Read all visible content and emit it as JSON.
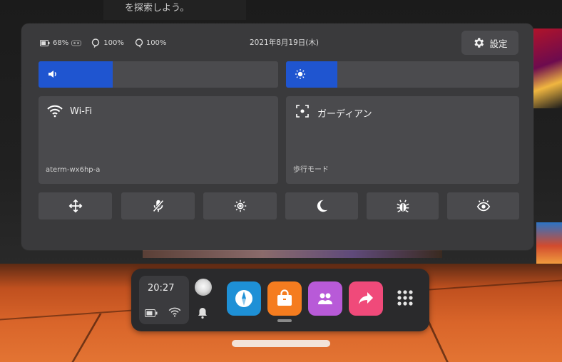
{
  "background": {
    "top_text": "を探索しよう。"
  },
  "status": {
    "headset_battery": "68%",
    "controller_left": "100%",
    "controller_right": "100%",
    "date": "2021年8月19日(木)"
  },
  "settings_button": {
    "label": "設定",
    "icon": "gear-icon"
  },
  "sliders": {
    "volume": {
      "icon": "speaker-icon",
      "level_percent": 31
    },
    "brightness": {
      "icon": "sun-icon",
      "level_percent": 22
    }
  },
  "tiles": {
    "wifi": {
      "icon": "wifi-icon",
      "title": "Wi-Fi",
      "subtitle": "aterm-wx6hp-a"
    },
    "guardian": {
      "icon": "guardian-icon",
      "title": "ガーディアン",
      "subtitle": "歩行モード"
    }
  },
  "quick_buttons": [
    {
      "name": "recenter",
      "icon": "move-arrows-icon"
    },
    {
      "name": "mic-mute",
      "icon": "mic-off-icon"
    },
    {
      "name": "brightness",
      "icon": "sun-icon"
    },
    {
      "name": "night-mode",
      "icon": "moon-icon"
    },
    {
      "name": "bug-report",
      "icon": "bug-icon"
    },
    {
      "name": "passthrough",
      "icon": "eye-icon"
    }
  ],
  "dock": {
    "time": "20:27",
    "apps": [
      {
        "name": "explore",
        "icon": "compass-icon",
        "color": "#1e90d6"
      },
      {
        "name": "store",
        "icon": "shopping-bag-icon",
        "color": "#f57c1f"
      },
      {
        "name": "people",
        "icon": "people-icon",
        "color": "#b85ad8"
      },
      {
        "name": "share",
        "icon": "share-arrow-icon",
        "color": "#f04a7a"
      }
    ]
  },
  "colors": {
    "accent": "#1f55d0",
    "panel": "#3a3a3c",
    "tile": "#4a4a4d"
  }
}
